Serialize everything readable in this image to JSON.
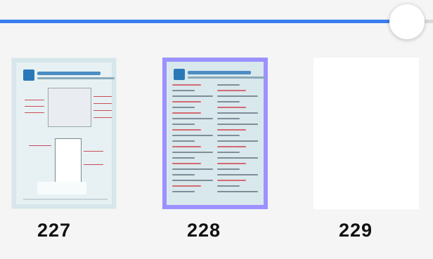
{
  "slider": {
    "progress_fraction": 0.94,
    "colors": {
      "fill": "#3a7df0",
      "track": "#d9d9d9",
      "thumb": "#ffffff"
    }
  },
  "pages": [
    {
      "number": "227",
      "selected": false
    },
    {
      "number": "228",
      "selected": true
    },
    {
      "number": "229",
      "selected": false
    }
  ],
  "colors": {
    "selection_border": "#9b92ff",
    "background": "#f5f5f5"
  }
}
